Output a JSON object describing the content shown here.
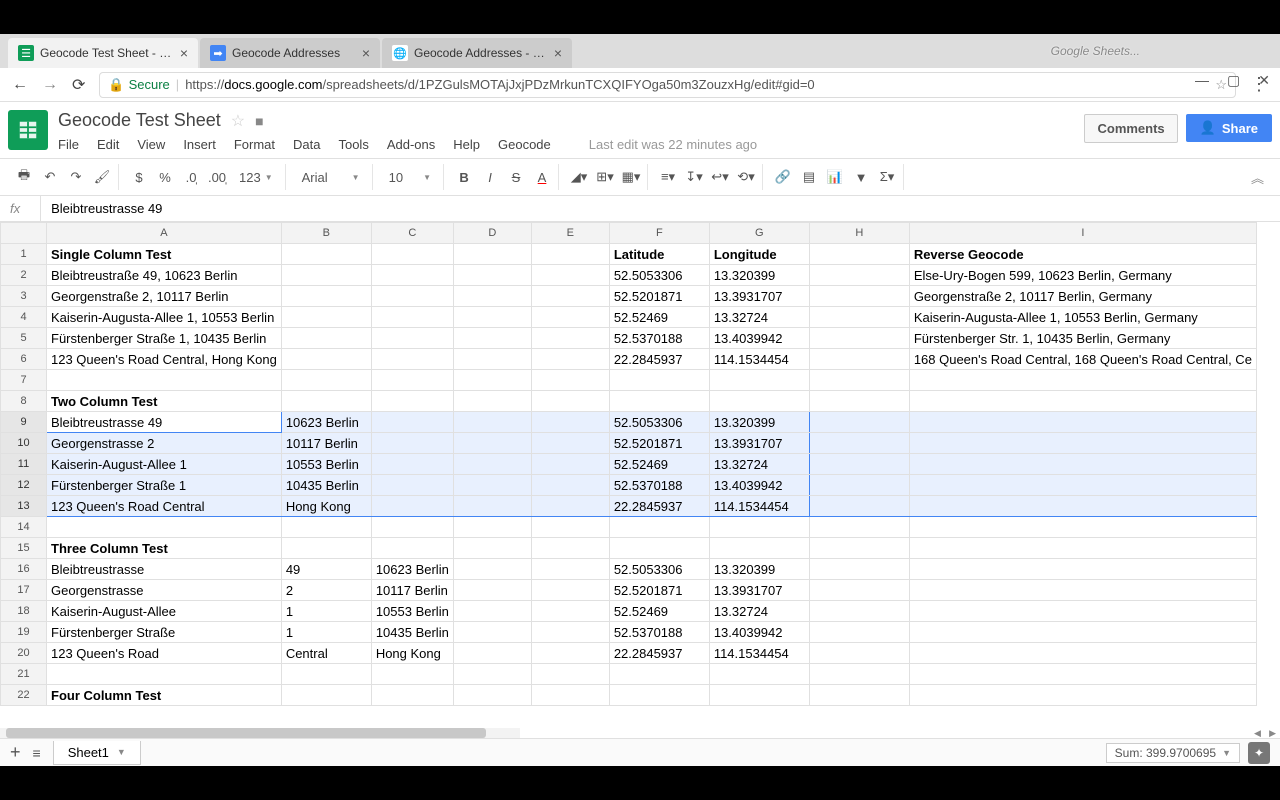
{
  "browser": {
    "tabs": [
      {
        "title": "Geocode Test Sheet - Go",
        "active": true,
        "fav_bg": "#0f9d58",
        "fav_text": "☰"
      },
      {
        "title": "Geocode Addresses",
        "active": false,
        "fav_bg": "#4285f4",
        "fav_text": "➡"
      },
      {
        "title": "Geocode Addresses - Edi",
        "active": false,
        "fav_bg": "#fff",
        "fav_text": "🌐"
      }
    ],
    "overlay_text": "Google Sheets...",
    "secure_label": "Secure",
    "url_proto": "https://",
    "url_domain": "docs.google.com",
    "url_path": "/spreadsheets/d/1PZGulsMOTAjJxjPDzMrkunTCXQIFYOga50m3ZouzxHg/edit#gid=0"
  },
  "doc": {
    "title": "Geocode Test Sheet",
    "menus": [
      "File",
      "Edit",
      "View",
      "Insert",
      "Format",
      "Data",
      "Tools",
      "Add-ons",
      "Help",
      "Geocode"
    ],
    "last_edit": "Last edit was 22 minutes ago",
    "comments_btn": "Comments",
    "share_btn": "Share",
    "font_name": "Arial",
    "font_size": "10",
    "formula_value": "Bleibtreustrasse 49",
    "sheet_tab": "Sheet1",
    "sum_text": "Sum: 399.9700695"
  },
  "grid": {
    "columns": [
      "A",
      "B",
      "C",
      "D",
      "E",
      "F",
      "G",
      "H",
      "I"
    ],
    "rows": [
      {
        "n": 1,
        "bold": true,
        "A": "Single Column Test",
        "F": "Latitude",
        "G": "Longitude",
        "I": "Reverse Geocode"
      },
      {
        "n": 2,
        "A": "Bleibtreustraße 49, 10623 Berlin",
        "F": "52.5053306",
        "G": "13.320399",
        "I": "Else-Ury-Bogen 599, 10623 Berlin, Germany"
      },
      {
        "n": 3,
        "A": "Georgenstraße 2, 10117 Berlin",
        "F": "52.5201871",
        "G": "13.3931707",
        "I": "Georgenstraße 2, 10117 Berlin, Germany"
      },
      {
        "n": 4,
        "A": "Kaiserin-Augusta-Allee 1, 10553 Berlin",
        "F": "52.52469",
        "G": "13.32724",
        "I": "Kaiserin-Augusta-Allee 1, 10553 Berlin, Germany"
      },
      {
        "n": 5,
        "A": "Fürstenberger Straße 1, 10435 Berlin",
        "F": "52.5370188",
        "G": "13.4039942",
        "I": "Fürstenberger Str. 1, 10435 Berlin, Germany"
      },
      {
        "n": 6,
        "A": "123 Queen's Road Central, Hong Kong",
        "F": "22.2845937",
        "G": "114.1534454",
        "I": "168 Queen's Road Central, 168 Queen's Road Central, Ce"
      },
      {
        "n": 7
      },
      {
        "n": 8,
        "bold": true,
        "A": "Two Column Test"
      },
      {
        "n": 9,
        "sel": true,
        "active": true,
        "A": "Bleibtreustrasse 49",
        "B": "10623 Berlin",
        "F": "52.5053306",
        "G": "13.320399"
      },
      {
        "n": 10,
        "sel": true,
        "A": "Georgenstrasse 2",
        "B": "10117 Berlin",
        "F": "52.5201871",
        "G": "13.3931707"
      },
      {
        "n": 11,
        "sel": true,
        "A": "Kaiserin-August-Allee 1",
        "B": "10553 Berlin",
        "F": "52.52469",
        "G": "13.32724"
      },
      {
        "n": 12,
        "sel": true,
        "A": "Fürstenberger Straße 1",
        "B": "10435 Berlin",
        "F": "52.5370188",
        "G": "13.4039942"
      },
      {
        "n": 13,
        "sel": true,
        "A": "123 Queen's Road Central",
        "B": "Hong Kong",
        "F": "22.2845937",
        "G": "114.1534454"
      },
      {
        "n": 14
      },
      {
        "n": 15,
        "bold": true,
        "A": "Three Column Test"
      },
      {
        "n": 16,
        "A": "Bleibtreustrasse",
        "B": "49",
        "C": "10623 Berlin",
        "F": "52.5053306",
        "G": "13.320399"
      },
      {
        "n": 17,
        "A": "Georgenstrasse",
        "B": "2",
        "C": "10117 Berlin",
        "F": "52.5201871",
        "G": "13.3931707"
      },
      {
        "n": 18,
        "A": "Kaiserin-August-Allee",
        "B": "1",
        "C": "10553 Berlin",
        "F": "52.52469",
        "G": "13.32724"
      },
      {
        "n": 19,
        "A": "Fürstenberger Straße",
        "B": "1",
        "C": "10435 Berlin",
        "F": "52.5370188",
        "G": "13.4039942"
      },
      {
        "n": 20,
        "A": "123 Queen's Road",
        "B": "Central",
        "C": "Hong Kong",
        "F": "22.2845937",
        "G": "114.1534454"
      },
      {
        "n": 21
      },
      {
        "n": 22,
        "bold": true,
        "A": "Four Column Test"
      }
    ]
  }
}
